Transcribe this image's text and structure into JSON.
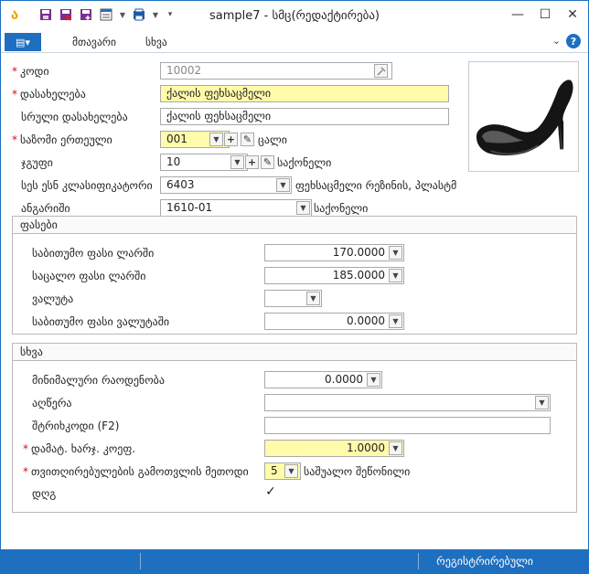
{
  "window": {
    "title": "sample7 - სმც(რედაქტირება)",
    "controls": {
      "minimize": "—",
      "maximize": "☐",
      "close": "✕"
    }
  },
  "menu": {
    "file_icon": "▤▾",
    "items": [
      "მთავარი",
      "სხვა"
    ],
    "collapse": "⌄",
    "help": "?"
  },
  "form": {
    "code": {
      "label": "კოდი",
      "value": "10002"
    },
    "name": {
      "label": "დასახელება",
      "value": "ქალის ფეხსაცმელი"
    },
    "full_name": {
      "label": "სრული დასახელება",
      "value": "ქალის ფეხსაცმელი"
    },
    "unit": {
      "label": "საზომი ერთეული",
      "value": "001",
      "suffix": "ცალი"
    },
    "group": {
      "label": "ჯგუფი",
      "value": "10",
      "suffix": "საქონელი"
    },
    "hs_code": {
      "label": "სეს ესნ კლასიფიკატორი",
      "value": "6403",
      "suffix": "ფეხსაცმელი რეზინის, პლასტმ"
    },
    "account": {
      "label": "ანგარიში",
      "value": "1610-01",
      "suffix": "საქონელი"
    }
  },
  "prices": {
    "title": "ფასები",
    "purchase_gel": {
      "label": "საბითუმო ფასი ლარში",
      "value": "170.0000"
    },
    "retail_gel": {
      "label": "საცალო ფასი ლარში",
      "value": "185.0000"
    },
    "currency": {
      "label": "ვალუტა",
      "value": ""
    },
    "purchase_cur": {
      "label": "საბითუმო ფასი ვალუტაში",
      "value": "0.0000"
    }
  },
  "other": {
    "title": "სხვა",
    "min_qty": {
      "label": "მინიმალური რაოდენობა",
      "value": "0.0000"
    },
    "description": {
      "label": "აღწერა",
      "value": ""
    },
    "barcode": {
      "label": "შტრიხკოდი (F2)",
      "value": ""
    },
    "extra_coef": {
      "label": "დამატ. ხარჯ. კოეფ.",
      "value": "1.0000"
    },
    "cost_method": {
      "label": "თვითღირებულების გამოთვლის მეთოდი",
      "value": "5",
      "suffix": "საშუალო შეწონილი"
    },
    "vat": {
      "label": "დღგ",
      "checked": "✓"
    }
  },
  "status": {
    "text": "რეგისტრირებული"
  }
}
